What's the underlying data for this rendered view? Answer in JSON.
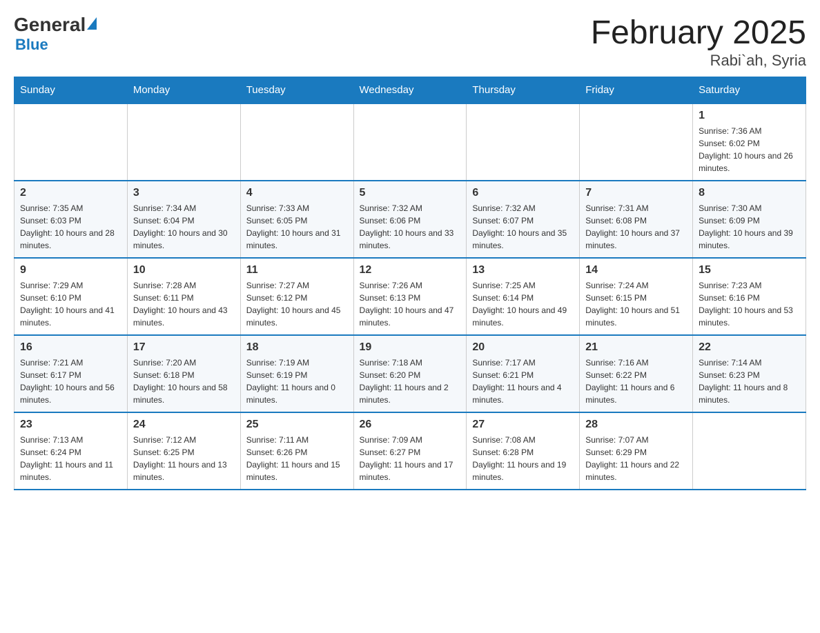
{
  "header": {
    "logo_general": "General",
    "logo_blue": "Blue",
    "title": "February 2025",
    "location": "Rabi`ah, Syria"
  },
  "days_of_week": [
    "Sunday",
    "Monday",
    "Tuesday",
    "Wednesday",
    "Thursday",
    "Friday",
    "Saturday"
  ],
  "weeks": [
    [
      {
        "day": "",
        "info": ""
      },
      {
        "day": "",
        "info": ""
      },
      {
        "day": "",
        "info": ""
      },
      {
        "day": "",
        "info": ""
      },
      {
        "day": "",
        "info": ""
      },
      {
        "day": "",
        "info": ""
      },
      {
        "day": "1",
        "info": "Sunrise: 7:36 AM\nSunset: 6:02 PM\nDaylight: 10 hours and 26 minutes."
      }
    ],
    [
      {
        "day": "2",
        "info": "Sunrise: 7:35 AM\nSunset: 6:03 PM\nDaylight: 10 hours and 28 minutes."
      },
      {
        "day": "3",
        "info": "Sunrise: 7:34 AM\nSunset: 6:04 PM\nDaylight: 10 hours and 30 minutes."
      },
      {
        "day": "4",
        "info": "Sunrise: 7:33 AM\nSunset: 6:05 PM\nDaylight: 10 hours and 31 minutes."
      },
      {
        "day": "5",
        "info": "Sunrise: 7:32 AM\nSunset: 6:06 PM\nDaylight: 10 hours and 33 minutes."
      },
      {
        "day": "6",
        "info": "Sunrise: 7:32 AM\nSunset: 6:07 PM\nDaylight: 10 hours and 35 minutes."
      },
      {
        "day": "7",
        "info": "Sunrise: 7:31 AM\nSunset: 6:08 PM\nDaylight: 10 hours and 37 minutes."
      },
      {
        "day": "8",
        "info": "Sunrise: 7:30 AM\nSunset: 6:09 PM\nDaylight: 10 hours and 39 minutes."
      }
    ],
    [
      {
        "day": "9",
        "info": "Sunrise: 7:29 AM\nSunset: 6:10 PM\nDaylight: 10 hours and 41 minutes."
      },
      {
        "day": "10",
        "info": "Sunrise: 7:28 AM\nSunset: 6:11 PM\nDaylight: 10 hours and 43 minutes."
      },
      {
        "day": "11",
        "info": "Sunrise: 7:27 AM\nSunset: 6:12 PM\nDaylight: 10 hours and 45 minutes."
      },
      {
        "day": "12",
        "info": "Sunrise: 7:26 AM\nSunset: 6:13 PM\nDaylight: 10 hours and 47 minutes."
      },
      {
        "day": "13",
        "info": "Sunrise: 7:25 AM\nSunset: 6:14 PM\nDaylight: 10 hours and 49 minutes."
      },
      {
        "day": "14",
        "info": "Sunrise: 7:24 AM\nSunset: 6:15 PM\nDaylight: 10 hours and 51 minutes."
      },
      {
        "day": "15",
        "info": "Sunrise: 7:23 AM\nSunset: 6:16 PM\nDaylight: 10 hours and 53 minutes."
      }
    ],
    [
      {
        "day": "16",
        "info": "Sunrise: 7:21 AM\nSunset: 6:17 PM\nDaylight: 10 hours and 56 minutes."
      },
      {
        "day": "17",
        "info": "Sunrise: 7:20 AM\nSunset: 6:18 PM\nDaylight: 10 hours and 58 minutes."
      },
      {
        "day": "18",
        "info": "Sunrise: 7:19 AM\nSunset: 6:19 PM\nDaylight: 11 hours and 0 minutes."
      },
      {
        "day": "19",
        "info": "Sunrise: 7:18 AM\nSunset: 6:20 PM\nDaylight: 11 hours and 2 minutes."
      },
      {
        "day": "20",
        "info": "Sunrise: 7:17 AM\nSunset: 6:21 PM\nDaylight: 11 hours and 4 minutes."
      },
      {
        "day": "21",
        "info": "Sunrise: 7:16 AM\nSunset: 6:22 PM\nDaylight: 11 hours and 6 minutes."
      },
      {
        "day": "22",
        "info": "Sunrise: 7:14 AM\nSunset: 6:23 PM\nDaylight: 11 hours and 8 minutes."
      }
    ],
    [
      {
        "day": "23",
        "info": "Sunrise: 7:13 AM\nSunset: 6:24 PM\nDaylight: 11 hours and 11 minutes."
      },
      {
        "day": "24",
        "info": "Sunrise: 7:12 AM\nSunset: 6:25 PM\nDaylight: 11 hours and 13 minutes."
      },
      {
        "day": "25",
        "info": "Sunrise: 7:11 AM\nSunset: 6:26 PM\nDaylight: 11 hours and 15 minutes."
      },
      {
        "day": "26",
        "info": "Sunrise: 7:09 AM\nSunset: 6:27 PM\nDaylight: 11 hours and 17 minutes."
      },
      {
        "day": "27",
        "info": "Sunrise: 7:08 AM\nSunset: 6:28 PM\nDaylight: 11 hours and 19 minutes."
      },
      {
        "day": "28",
        "info": "Sunrise: 7:07 AM\nSunset: 6:29 PM\nDaylight: 11 hours and 22 minutes."
      },
      {
        "day": "",
        "info": ""
      }
    ]
  ]
}
